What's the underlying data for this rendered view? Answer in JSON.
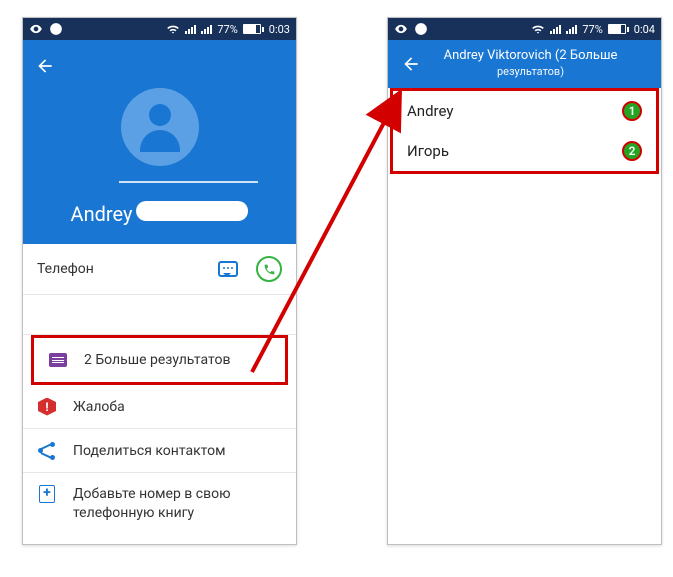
{
  "status1": {
    "battery": "77%",
    "time": "0:03"
  },
  "status2": {
    "battery": "77%",
    "time": "0:04"
  },
  "hero": {
    "name_visible": "Andrey"
  },
  "left": {
    "section_phone": "Телефон",
    "more_results": "2 Больше результатов",
    "complaint": "Жалоба",
    "share": "Поделиться контактом",
    "add_number": "Добавьте номер в свою телефонную книгу"
  },
  "right": {
    "title_top": "Andrey Viktorovich (2 Больше",
    "title_bottom": "результатов)",
    "results": [
      {
        "name": "Andrey",
        "badge": "1"
      },
      {
        "name": "Игорь",
        "badge": "2"
      }
    ]
  }
}
